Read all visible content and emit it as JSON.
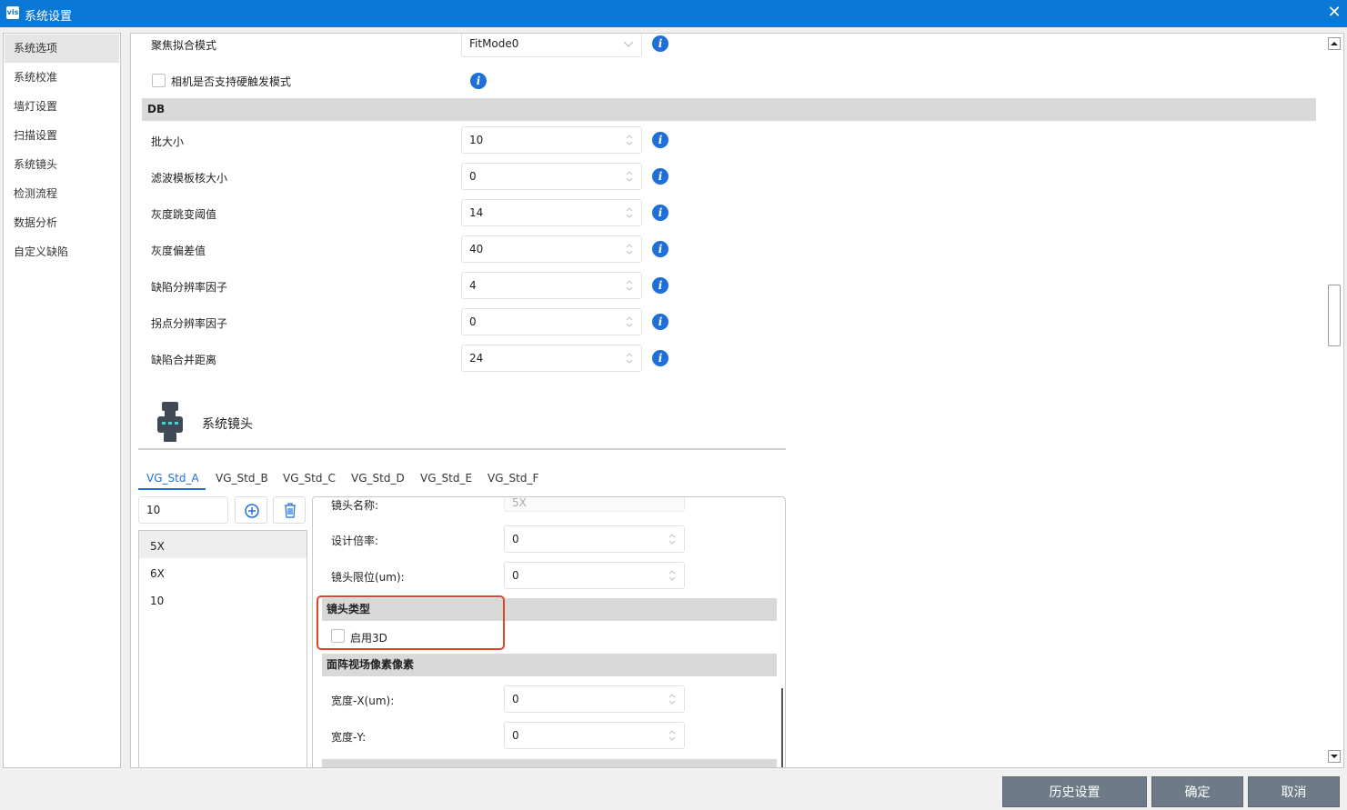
{
  "window": {
    "title": "系统设置",
    "logo": "vis"
  },
  "sidebar": {
    "items": [
      "系统选项",
      "系统校准",
      "墙灯设置",
      "扫描设置",
      "系统镜头",
      "检测流程",
      "数据分析",
      "自定义缺陷"
    ]
  },
  "top": {
    "fit_mode_label": "聚焦拟合模式",
    "fit_mode_value": "FitMode0",
    "hw_trigger_label": "相机是否支持硬触发模式"
  },
  "db": {
    "section_title": "DB",
    "rows": [
      {
        "label": "批大小",
        "value": "10"
      },
      {
        "label": "滤波模板核大小",
        "value": "0"
      },
      {
        "label": "灰度跳变阈值",
        "value": "14"
      },
      {
        "label": "灰度偏差值",
        "value": "40"
      },
      {
        "label": "缺陷分辨率因子",
        "value": "4"
      },
      {
        "label": "拐点分辨率因子",
        "value": "0"
      },
      {
        "label": "缺陷合并距离",
        "value": "24"
      }
    ]
  },
  "lens": {
    "header": "系统镜头",
    "tabs": [
      "VG_Std_A",
      "VG_Std_B",
      "VG_Std_C",
      "VG_Std_D",
      "VG_Std_E",
      "VG_Std_F"
    ],
    "search_value": "10",
    "list": [
      "5X",
      "6X",
      "10"
    ],
    "detail": {
      "name_label": "镜头名称:",
      "name_value": "5X",
      "mag_label": "设计倍率:",
      "mag_value": "0",
      "limit_label": "镜头限位(um):",
      "limit_value": "0",
      "type_section": "镜头类型",
      "enable3d_label": "启用3D",
      "fov_section": "面阵视场像素像素",
      "width_x_label": "宽度-X(um):",
      "width_x_value": "0",
      "width_y_label": "宽度-Y:",
      "width_y_value": "0"
    }
  },
  "footer": {
    "history": "历史设置",
    "ok": "确定",
    "cancel": "取消"
  },
  "colors": {
    "titlebar": "#0a78d4",
    "accent": "#1e6fd9",
    "highlight": "#e0442c",
    "button": "#6e7a87"
  }
}
